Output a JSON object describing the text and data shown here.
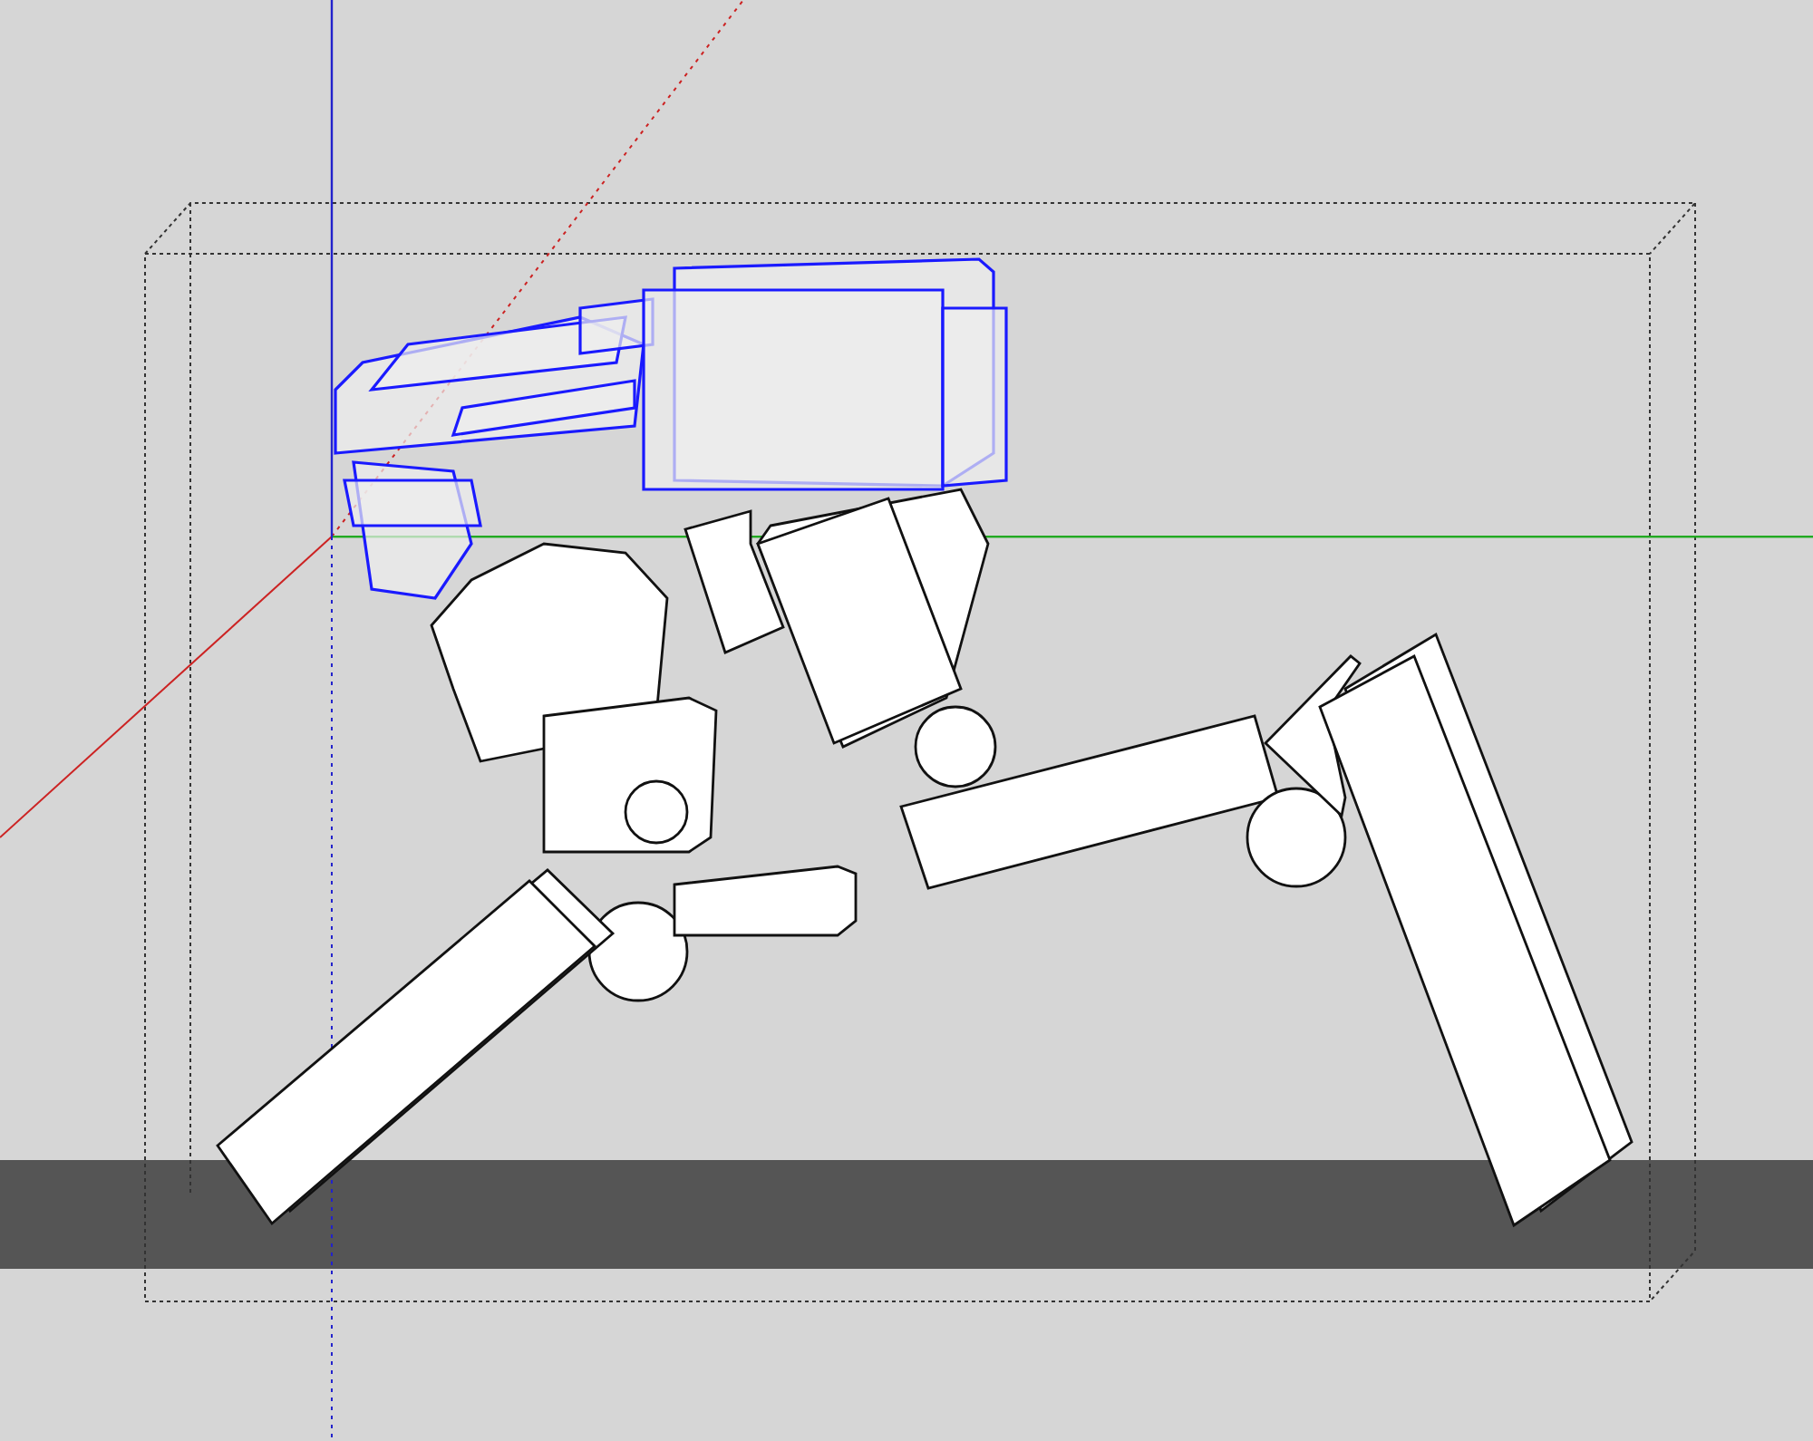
{
  "viewport": {
    "axes": [
      {
        "kind": "red",
        "color": "#cc2222"
      },
      {
        "kind": "green",
        "color": "#22aa22"
      },
      {
        "kind": "blue",
        "color": "#2222cc"
      }
    ],
    "parts": [
      {
        "kind": "head",
        "selected": true
      },
      {
        "kind": "torso",
        "selected": true
      },
      {
        "kind": "shoulder",
        "selected": false
      },
      {
        "kind": "upper-arm",
        "selected": false
      },
      {
        "kind": "elbow",
        "selected": false
      },
      {
        "kind": "forearm",
        "selected": false
      },
      {
        "kind": "rear-knee",
        "selected": false
      },
      {
        "kind": "rear-thigh",
        "selected": false
      },
      {
        "kind": "rear-shin",
        "selected": false
      },
      {
        "kind": "hip",
        "selected": false
      },
      {
        "kind": "thigh",
        "selected": false
      },
      {
        "kind": "front-knee",
        "selected": false
      },
      {
        "kind": "calf",
        "selected": false
      },
      {
        "kind": "front-shin",
        "selected": false
      }
    ]
  }
}
